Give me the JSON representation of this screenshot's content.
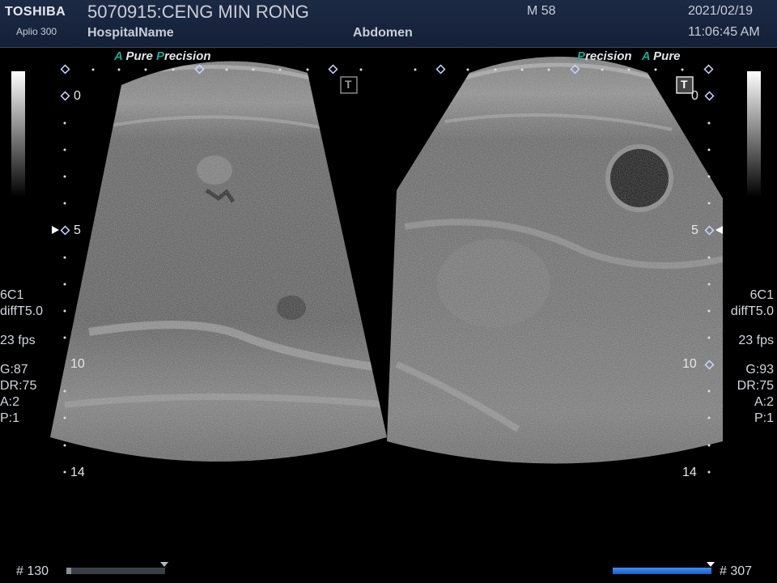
{
  "header": {
    "brand": "TOSHIBA",
    "model": "Aplio 300",
    "patient": "5070915:CENG MIN RONG",
    "hospital": "HospitalName",
    "exam": "Abdomen",
    "sex_age": "M 58",
    "date": "2021/02/19",
    "time": "11:06:45 AM"
  },
  "left_panel": {
    "tag_a": "A",
    "tag_pure": "Pure",
    "tag_p": "P",
    "tag_precision": "recision",
    "probe": "6C1",
    "mode": "diffT5.0",
    "fps": "23 fps",
    "gain": "G:87",
    "dr": "DR:75",
    "a": "A:2",
    "p": "P:1",
    "depth_0": "0",
    "depth_5": "5",
    "depth_10": "10",
    "depth_14": "14",
    "t_marker": "T"
  },
  "right_panel": {
    "tag_p": "P",
    "tag_precision": "recision",
    "tag_a": "A",
    "tag_pure": "Pure",
    "probe": "6C1",
    "mode": "diffT5.0",
    "fps": "23 fps",
    "gain": "G:93",
    "dr": "DR:75",
    "a": "A:2",
    "p": "P:1",
    "depth_0": "0",
    "depth_5": "5",
    "depth_10": "10",
    "depth_14": "14",
    "t_marker": "T"
  },
  "footer": {
    "left_frame": "# 130",
    "right_frame": "# 307",
    "left_cine_fraction": 0.05,
    "right_cine_fraction": 1.0
  },
  "colors": {
    "accent": "#1aa795",
    "header_bg": "#1a2640",
    "cine_active": "#1e6fd6",
    "cine_idle": "#3a3f46"
  }
}
